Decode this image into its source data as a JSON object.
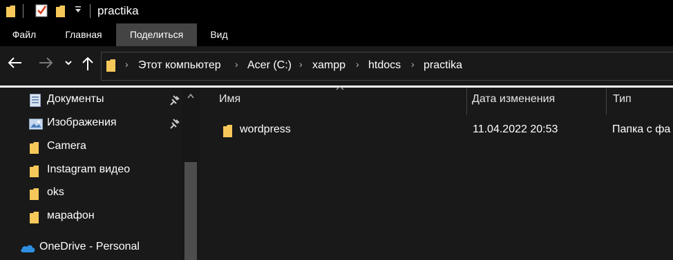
{
  "window": {
    "title": "practika",
    "qat_dropdown_icon": "chevron-down-icon"
  },
  "ribbon": {
    "tabs": [
      {
        "label": "Файл"
      },
      {
        "label": "Главная"
      },
      {
        "label": "Поделиться"
      },
      {
        "label": "Вид"
      }
    ],
    "active_tab": "Поделиться"
  },
  "address_bar": {
    "breadcrumbs": [
      {
        "label": "Этот компьютер"
      },
      {
        "label": "Acer (C:)"
      },
      {
        "label": "xampp"
      },
      {
        "label": "htdocs"
      },
      {
        "label": "practika"
      }
    ]
  },
  "sidebar": {
    "items": [
      {
        "label": "Документы",
        "icon": "documents-icon",
        "pinned": true
      },
      {
        "label": "Изображения",
        "icon": "pictures-icon",
        "pinned": true
      },
      {
        "label": "Camera",
        "icon": "folder-icon"
      },
      {
        "label": "Instagram видео",
        "icon": "folder-icon"
      },
      {
        "label": "oks",
        "icon": "folder-icon"
      },
      {
        "label": "марафон",
        "icon": "folder-icon"
      },
      {
        "label": "OneDrive - Personal",
        "icon": "onedrive-icon"
      }
    ]
  },
  "file_list": {
    "columns": [
      {
        "label": "Имя"
      },
      {
        "label": "Дата изменения"
      },
      {
        "label": "Тип"
      }
    ],
    "rows": [
      {
        "name": "wordpress",
        "modified": "11.04.2022 20:53",
        "type": "Папка с фа"
      }
    ]
  },
  "colors": {
    "background": "#191919",
    "folder": "#f6c85a",
    "active_tab": "#444444",
    "onedrive": "#2e8fe0"
  }
}
